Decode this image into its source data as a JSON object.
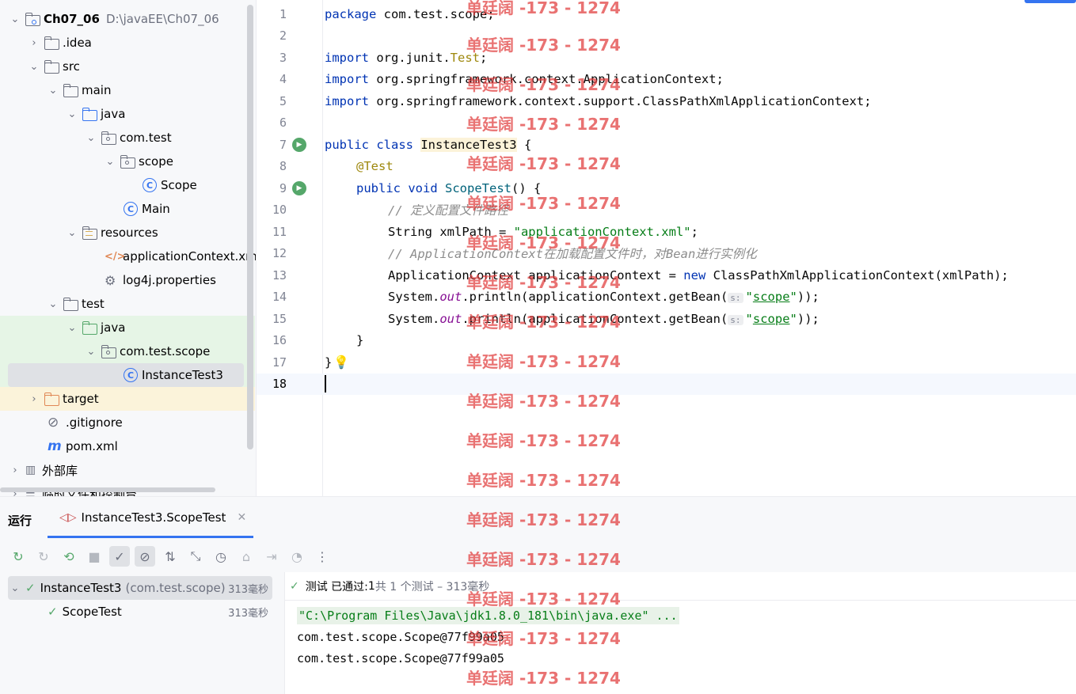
{
  "project_tree": {
    "root": {
      "name": "Ch07_06",
      "path": "D:\\javaEE\\Ch07_06"
    },
    "items": [
      {
        "label": ".idea"
      },
      {
        "label": "src"
      },
      {
        "label": "main"
      },
      {
        "label": "java"
      },
      {
        "label": "com.test"
      },
      {
        "label": "scope"
      },
      {
        "label": "Scope"
      },
      {
        "label": "Main"
      },
      {
        "label": "resources"
      },
      {
        "label": "applicationContext.xml"
      },
      {
        "label": "log4j.properties"
      },
      {
        "label": "test"
      },
      {
        "label": "java"
      },
      {
        "label": "com.test.scope"
      },
      {
        "label": "InstanceTest3"
      },
      {
        "label": "target"
      },
      {
        "label": ".gitignore"
      },
      {
        "label": "pom.xml"
      },
      {
        "label": "外部库"
      },
      {
        "label": "临时文件和控制台"
      }
    ]
  },
  "editor": {
    "line_numbers": [
      "1",
      "2",
      "3",
      "4",
      "5",
      "6",
      "7",
      "8",
      "9",
      "10",
      "11",
      "12",
      "13",
      "14",
      "15",
      "16",
      "17",
      "18"
    ],
    "code": {
      "l1_kw": "package",
      "l1_rest": " com.test.scope;",
      "imp_kw": "import",
      "l3_a": " org.junit.",
      "l3_b": "Test",
      "l3_c": ";",
      "l4": " org.springframework.context.ApplicationContext;",
      "l5": " org.springframework.context.support.ClassPathXmlApplicationContext;",
      "l7_kw": "public class",
      "l7_name": "InstanceTest3",
      "l7_end": " {",
      "l8": "@Test",
      "l9_kw": "public void",
      "l9_fn": "ScopeTest",
      "l9_end": "() {",
      "l10": "// 定义配置文件路径",
      "l11_a": "String xmlPath = ",
      "l11_str": "\"applicationContext.xml\"",
      "l11_end": ";",
      "l12": "// ApplicationContext在加载配置文件时，对Bean进行实例化",
      "l13_a": "ApplicationContext applicationContext = ",
      "l13_kw": "new",
      "l13_b": " ClassPathXmlApplicationContext(xmlPath);",
      "sys": "System.",
      "out": "out",
      "println": ".println(applicationContext.getBean(",
      "hint": "s:",
      "scope_str_q": "\"",
      "scope_str": "scope",
      "call_end": "));",
      "l16": "}",
      "l17": "}"
    }
  },
  "run_window": {
    "title": "运行",
    "tab_label": "InstanceTest3.ScopeTest",
    "toolbar_icons": [
      "rerun-icon",
      "rerun-failed-icon",
      "toggle-auto-test-icon",
      "stop-icon",
      "show-passed-icon",
      "show-ignored-icon",
      "sort-icon",
      "collapse-icon",
      "history-icon",
      "screenshot-icon",
      "import-icon",
      "coverage-icon",
      "more-icon"
    ],
    "tests": [
      {
        "name": "InstanceTest3",
        "package": "(com.test.scope)",
        "duration": "313毫秒"
      },
      {
        "name": "ScopeTest",
        "duration": "313毫秒"
      }
    ],
    "status": {
      "a": "测试 已通过: ",
      "passed": "1",
      "b": "共 1 个测试 – 313毫秒"
    },
    "console_lines": [
      "\"C:\\Program Files\\Java\\jdk1.8.0_181\\bin\\java.exe\" ...",
      "com.test.scope.Scope@77f99a05",
      "com.test.scope.Scope@77f99a05"
    ]
  },
  "watermark": "单廷阔 -173 - 1274",
  "colors": {
    "accent": "#3574f0",
    "keyword": "#0033b3",
    "string": "#067d17",
    "annotation": "#9e880d",
    "pass": "#55a76a",
    "watermark": "#e13c3c"
  }
}
